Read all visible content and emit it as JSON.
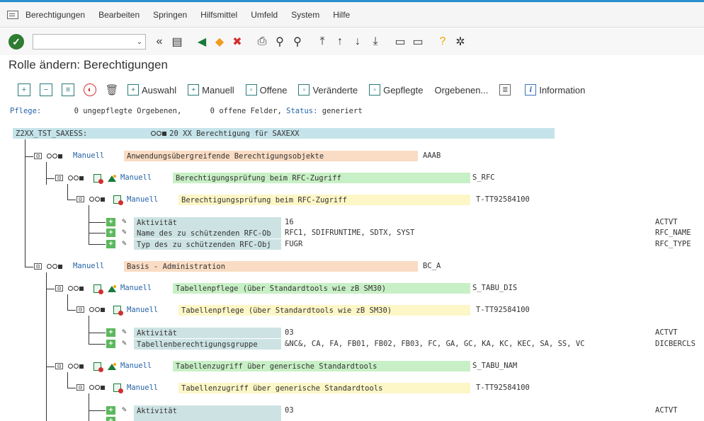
{
  "menu": [
    "Berechtigungen",
    "Bearbeiten",
    "Springen",
    "Hilfsmittel",
    "Umfeld",
    "System",
    "Hilfe"
  ],
  "title": "Rolle ändern: Berechtigungen",
  "app_toolbar": {
    "auswahl": "Auswahl",
    "manuell": "Manuell",
    "offene": "Offene",
    "veraenderte": "Veränderte",
    "gepflegte": "Gepflegte",
    "orgebenen": "Orgebenen...",
    "information": "Information"
  },
  "status": {
    "label": "Pflege:",
    "count1": "0",
    "text1": "ungepflegte Orgebenen,",
    "count2": "0",
    "text2": "offene Felder,",
    "status_label": "Status:",
    "status_value": "generiert"
  },
  "tree": {
    "root_id": "Z2XX_TST_SAXESS:",
    "root_text": "20 XX Berechtigung für SAXEXX",
    "manuell": "Manuell",
    "n1_text": "Anwendungsübergreifende Berechtigungsobjekte",
    "n1_code": "AAAB",
    "n1a_text": "Berechtigungsprüfung beim RFC-Zugriff",
    "n1a_code": "S_RFC",
    "n1b_text": "Berechtigungsprüfung beim RFC-Zugriff",
    "n1b_code": "T-TT92584100",
    "f1_label": "Aktivität",
    "f1_value": "16",
    "f1_field": "ACTVT",
    "f2_label": "Name des zu schützenden RFC-Ob",
    "f2_value": "RFC1, SDIFRUNTIME, SDTX, SYST",
    "f2_field": "RFC_NAME",
    "f3_label": "Typ des zu schützenden RFC-Obj",
    "f3_value": "FUGR",
    "f3_field": "RFC_TYPE",
    "n2_text": "Basis - Administration",
    "n2_code": "BC_A",
    "n2a_text": "Tabellenpflege (über Standardtools wie zB SM30)",
    "n2a_code": "S_TABU_DIS",
    "n2b_text": "Tabellenpflege (über Standardtools wie zB SM30)",
    "n2b_code": "T-TT92584100",
    "f4_label": "Aktivität",
    "f4_value": "03",
    "f4_field": "ACTVT",
    "f5_label": "Tabellenberechtigungsgruppe",
    "f5_value": "&NC&, CA, FA, FB01, FB02, FB03, FC, GA, GC, KA, KC, KEC, SA, SS, VC",
    "f5_field": "DICBERCLS",
    "n2c_text": "Tabellenzugriff über generische Standardtools",
    "n2c_code": "S_TABU_NAM",
    "n2d_text": "Tabellenzugriff über generische Standardtools",
    "n2d_code": "T-TT92584100",
    "f6_label": "Aktivität",
    "f6_value": "03",
    "f6_field": "ACTVT"
  }
}
